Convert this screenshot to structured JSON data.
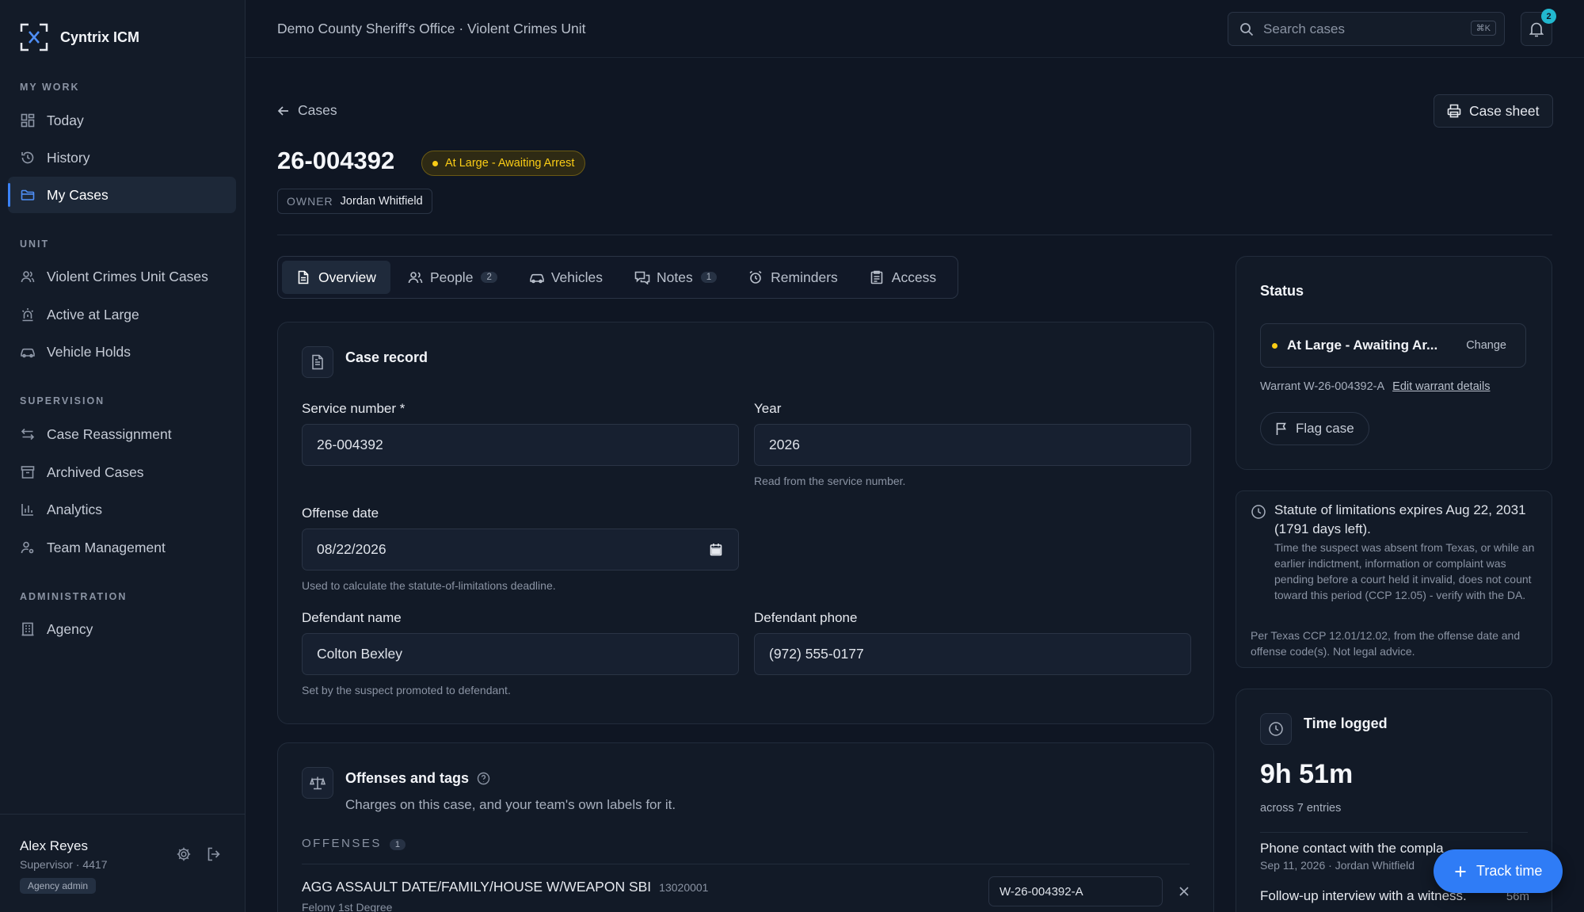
{
  "app": {
    "name": "Cyntrix ICM"
  },
  "sidebar": {
    "sections": [
      {
        "label": "MY WORK",
        "items": [
          {
            "label": "Today",
            "icon": "grid-icon"
          },
          {
            "label": "History",
            "icon": "history-icon"
          },
          {
            "label": "My Cases",
            "icon": "folder-icon",
            "active": true
          }
        ]
      },
      {
        "label": "UNIT",
        "items": [
          {
            "label": "Violent Crimes Unit Cases",
            "icon": "users-icon"
          },
          {
            "label": "Active at Large",
            "icon": "siren-icon"
          },
          {
            "label": "Vehicle Holds",
            "icon": "car-icon"
          }
        ]
      },
      {
        "label": "SUPERVISION",
        "items": [
          {
            "label": "Case Reassignment",
            "icon": "swap-icon"
          },
          {
            "label": "Archived Cases",
            "icon": "archive-icon"
          },
          {
            "label": "Analytics",
            "icon": "bar-chart-icon"
          },
          {
            "label": "Team Management",
            "icon": "user-cog-icon"
          }
        ]
      },
      {
        "label": "ADMINISTRATION",
        "items": [
          {
            "label": "Agency",
            "icon": "building-icon"
          }
        ]
      }
    ],
    "user": {
      "name": "Alex Reyes",
      "role": "Supervisor · 4417",
      "badge": "Agency admin"
    }
  },
  "topbar": {
    "title": "Demo County Sheriff's Office · Violent Crimes Unit",
    "search_placeholder": "Search cases",
    "search_shortcut": "⌘K",
    "notification_count": "2"
  },
  "case": {
    "back_label": "Cases",
    "sheet_label": "Case sheet",
    "id": "26-004392",
    "status": "At Large - Awaiting Arrest",
    "owner_key": "OWNER",
    "owner_value": "Jordan Whitfield",
    "colors": {
      "accent": "#2f7cf6",
      "status": "#facc15"
    }
  },
  "tabs": [
    {
      "label": "Overview",
      "icon": "document-icon",
      "active": true,
      "count": ""
    },
    {
      "label": "People",
      "icon": "people-icon",
      "count": "2"
    },
    {
      "label": "Vehicles",
      "icon": "car-icon",
      "count": ""
    },
    {
      "label": "Notes",
      "icon": "chat-icon",
      "count": "1"
    },
    {
      "label": "Reminders",
      "icon": "alarm-icon",
      "count": ""
    },
    {
      "label": "Access",
      "icon": "clipboard-icon",
      "count": ""
    }
  ],
  "record": {
    "title": "Case record",
    "service_label": "Service number *",
    "service_value": "26-004392",
    "year_label": "Year",
    "year_value": "2026",
    "year_hint": "Read from the service number.",
    "offense_date_label": "Offense date",
    "offense_date_value": "08/22/2026",
    "offense_date_hint": "Used to calculate the statute-of-limitations deadline.",
    "defendant_label": "Defendant name",
    "defendant_value": "Colton Bexley",
    "defendant_hint": "Set by the suspect promoted to defendant.",
    "phone_label": "Defendant phone",
    "phone_value": "(972) 555-0177"
  },
  "offenses": {
    "title": "Offenses and tags",
    "subtitle": "Charges on this case, and your team's own labels for it.",
    "heading": "OFFENSES",
    "count": "1",
    "items": [
      {
        "name": "AGG ASSAULT DATE/FAMILY/HOUSE W/WEAPON SBI",
        "code": "13020001",
        "degree": "Felony 1st Degree",
        "warrant": "W-26-004392-A"
      }
    ]
  },
  "status_card": {
    "title": "Status",
    "value": "At Large - Awaiting Ar...",
    "change_label": "Change",
    "warrant_text": "Warrant W-26-004392-A",
    "edit_label": "Edit warrant details",
    "flag_label": "Flag case"
  },
  "sol_card": {
    "headline": "Statute of limitations expires Aug 22, 2031 (1791 days left).",
    "body": "Time the suspect was absent from Texas, or while an earlier indictment, information or complaint was pending before a court held it invalid, does not count toward this period (CCP 12.05) - verify with the DA.",
    "footnote": "Per Texas CCP 12.01/12.02, from the offense date and offense code(s). Not legal advice."
  },
  "time_card": {
    "title": "Time logged",
    "total": "9h 51m",
    "entries": "across 7 entries",
    "items": [
      {
        "title": "Phone contact with the compla",
        "meta": "Sep 11, 2026 · Jordan Whitfield",
        "duration": ""
      },
      {
        "title": "Follow-up interview with a witness.",
        "meta": "",
        "duration": "56m"
      }
    ],
    "track_label": "Track time"
  }
}
